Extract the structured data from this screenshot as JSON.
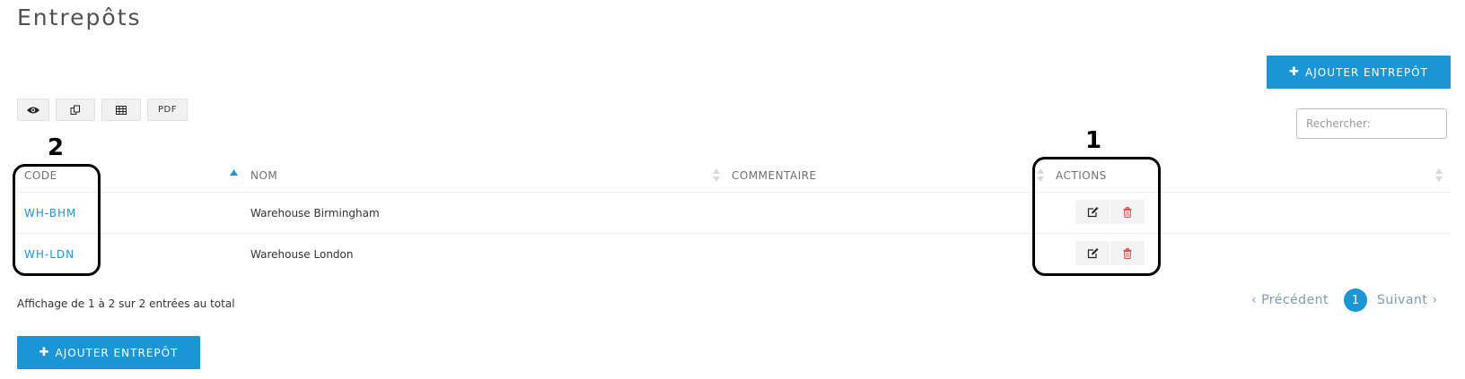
{
  "page": {
    "title": "Entrepôts"
  },
  "toolbar": {
    "add_label": "AJOUTER ENTREPÔT",
    "export_buttons": [
      {
        "name": "column-visibility",
        "icon": "eye-icon",
        "label": ""
      },
      {
        "name": "copy",
        "icon": "copy-icon",
        "label": ""
      },
      {
        "name": "spreadsheet",
        "icon": "table-icon",
        "label": ""
      },
      {
        "name": "pdf",
        "icon": "",
        "label": "PDF"
      }
    ],
    "search": {
      "placeholder": "Rechercher:",
      "value": ""
    }
  },
  "table": {
    "columns": [
      "CODE",
      "NOM",
      "COMMENTAIRE",
      "ACTIONS"
    ],
    "sorted_column": "CODE",
    "rows": [
      {
        "code": "WH-BHM",
        "name": "Warehouse Birmingham",
        "comment": ""
      },
      {
        "code": "WH-LDN",
        "name": "Warehouse London",
        "comment": ""
      }
    ]
  },
  "footer": {
    "info": "Affichage de 1 à 2 sur 2 entrées au total",
    "pagination": {
      "previous": "Précédent",
      "current": "1",
      "next": "Suivant"
    }
  },
  "annotations": [
    {
      "label": "1",
      "target": "actions-column"
    },
    {
      "label": "2",
      "target": "code-column"
    }
  ],
  "colors": {
    "primary": "#1a96d4",
    "link": "#1a96d4",
    "delete": "#e05050",
    "annotation": "#000000"
  }
}
